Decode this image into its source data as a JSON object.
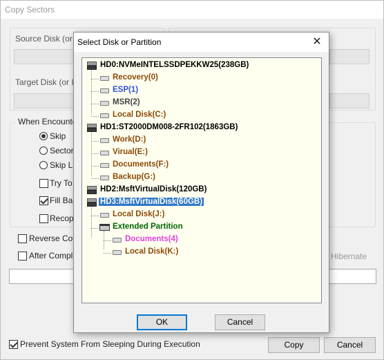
{
  "window": {
    "title": "Copy Sectors"
  },
  "main": {
    "source_label": "Source Disk (or I",
    "target_label": "Target Disk (or In",
    "when_group_label": "When Encounte",
    "options": [
      {
        "label": "Skip",
        "checked": true
      },
      {
        "label": "Sector-",
        "checked": false
      },
      {
        "label": "Skip La",
        "checked": false
      }
    ],
    "checks": [
      {
        "label": "Try To C",
        "checked": false
      },
      {
        "label": "Fill Bac",
        "checked": true
      },
      {
        "label": "Recopy",
        "checked": false
      }
    ],
    "reverse_label": "Reverse Cop",
    "after_label": "After Compl",
    "hibernate_label": "Hibernate",
    "prevent_sleep_label": "Prevent System From Sleeping During Execution",
    "prevent_sleep_checked": true,
    "copy_button": "Copy",
    "cancel_button": "Cancel"
  },
  "dialog": {
    "title": "Select Disk or Partition",
    "close_glyph": "✕",
    "ok_button": "OK",
    "cancel_button": "Cancel",
    "tree": [
      {
        "label": "HD0:NVMeINTELSSDPEKKW25(238GB)",
        "kind": "disk"
      },
      {
        "label": "Recovery(0)",
        "kind": "part"
      },
      {
        "label": "ESP(1)",
        "kind": "esp"
      },
      {
        "label": "MSR(2)",
        "kind": "msr"
      },
      {
        "label": "Local Disk(C:)",
        "kind": "part"
      },
      {
        "label": "HD1:ST2000DM008-2FR102(1863GB)",
        "kind": "disk"
      },
      {
        "label": "Work(D:)",
        "kind": "part"
      },
      {
        "label": "Virual(E:)",
        "kind": "part"
      },
      {
        "label": "Documents(F:)",
        "kind": "part"
      },
      {
        "label": "Backup(G:)",
        "kind": "part"
      },
      {
        "label": "HD2:MsftVirtualDisk(120GB)",
        "kind": "disk"
      },
      {
        "label": "HD3:MsftVirtualDisk(60GB)",
        "kind": "disk",
        "selected": true
      },
      {
        "label": "Local Disk(J:)",
        "kind": "part"
      },
      {
        "label": "Extended Partition",
        "kind": "ext"
      },
      {
        "label": "Documents(4)",
        "kind": "doc4"
      },
      {
        "label": "Local Disk(K:)",
        "kind": "part"
      }
    ]
  },
  "colors": {
    "selection": "#3178c6",
    "partition_text": "#8b4a05",
    "esp_text": "#3050d8",
    "extended_text": "#006400",
    "logical_pink": "#e040e0",
    "tree_background": "#fffff0"
  }
}
